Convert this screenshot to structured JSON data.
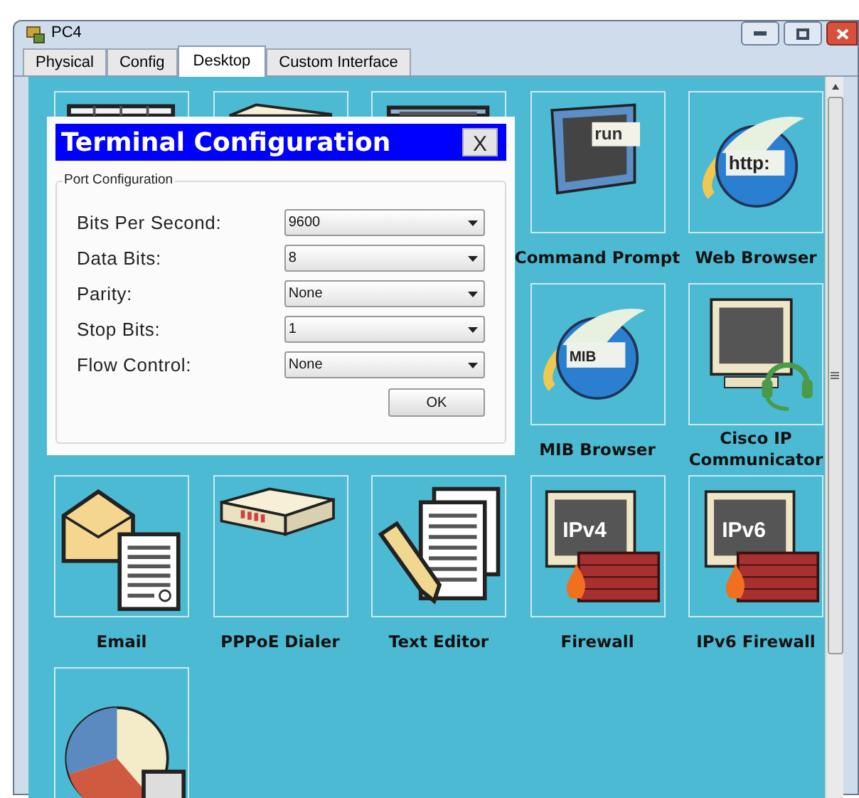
{
  "window": {
    "title": "PC4"
  },
  "tabs": [
    {
      "label": "Physical",
      "selected": false
    },
    {
      "label": "Config",
      "selected": false
    },
    {
      "label": "Desktop",
      "selected": true
    },
    {
      "label": "Custom Interface",
      "selected": false
    }
  ],
  "apps": [
    {
      "kind": "panels"
    },
    {
      "kind": "device"
    },
    {
      "kind": "monitor"
    },
    {
      "kind": "run",
      "label": "Command Prompt",
      "icon_text": "run"
    },
    {
      "kind": "globe",
      "label": "Web Browser",
      "icon_text": "http:"
    },
    {
      "kind": "covered"
    },
    {
      "kind": "covered"
    },
    {
      "kind": "covered"
    },
    {
      "kind": "globe",
      "label": "MIB Browser",
      "icon_text": "MIB"
    },
    {
      "kind": "headset",
      "label": "Cisco IP Communicator"
    },
    {
      "kind": "mail",
      "label": "Email"
    },
    {
      "kind": "router",
      "label": "PPPoE Dialer"
    },
    {
      "kind": "document",
      "label": "Text Editor"
    },
    {
      "kind": "firewall",
      "label": "Firewall",
      "icon_text": "IPv4"
    },
    {
      "kind": "firewall",
      "label": "IPv6 Firewall",
      "icon_text": "IPv6"
    },
    {
      "kind": "pie"
    }
  ],
  "dialog": {
    "title": "Terminal Configuration",
    "close": "X",
    "group": "Port Configuration",
    "fields": [
      {
        "label": "Bits Per Second:",
        "value": "9600"
      },
      {
        "label": "Data Bits:",
        "value": "8"
      },
      {
        "label": "Parity:",
        "value": "None"
      },
      {
        "label": "Stop Bits:",
        "value": "1"
      },
      {
        "label": "Flow Control:",
        "value": "None"
      }
    ],
    "ok": "OK"
  }
}
